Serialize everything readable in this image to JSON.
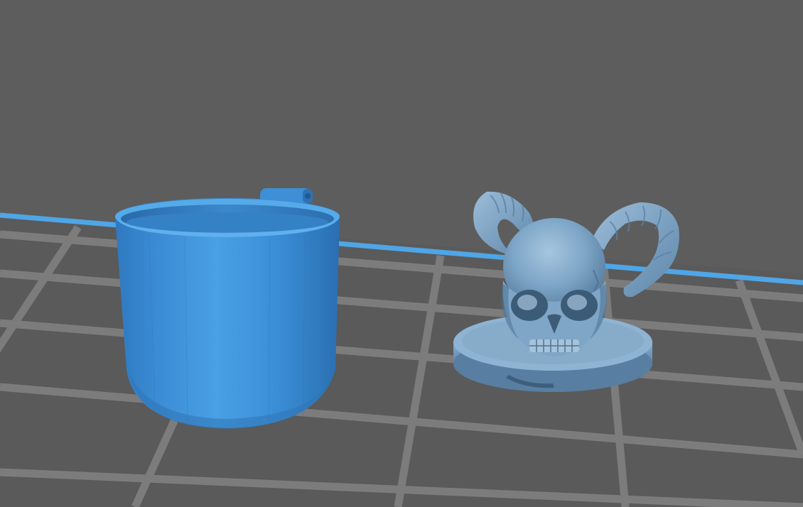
{
  "viewport": {
    "background_color": "#5d5d5d",
    "plate_color": "#6f6f6f",
    "grid_line_color": "#8b8b8b",
    "axis_line_color": "#4fa6e6"
  },
  "objects": [
    {
      "name": "cup",
      "color": "#3f92d8",
      "highlight": "#5fb0ee",
      "shadow": "#2f74b5"
    },
    {
      "name": "horned-skull-on-base",
      "color": "#6e99bd",
      "highlight": "#9dc0dc",
      "shadow": "#4d7394"
    }
  ]
}
